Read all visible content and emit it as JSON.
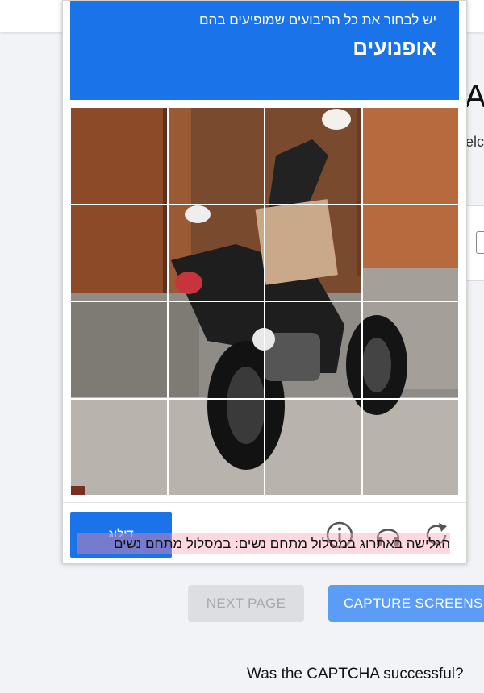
{
  "page": {
    "heading": "A",
    "text_fragment": "elc"
  },
  "buttons": {
    "next_page": "NEXT PAGE",
    "capture": "CAPTURE SCREENS"
  },
  "question": "Was the CAPTCHA successful?",
  "captcha": {
    "instruction": "יש לבחור את כל הריבועים שמופיעים בהם",
    "object": "אופנועים",
    "skip_label": "דילוג",
    "icons": [
      "refresh-icon",
      "audio-icon",
      "info-icon"
    ],
    "overlay_caption": "הגלישה באתרוג במסלול מתחם נשים: במסלול מתחם נשים"
  },
  "colors": {
    "captcha_blue": "#1a73e8",
    "capture_button": "#5b9cf6",
    "disabled_button": "#dcdee2"
  }
}
